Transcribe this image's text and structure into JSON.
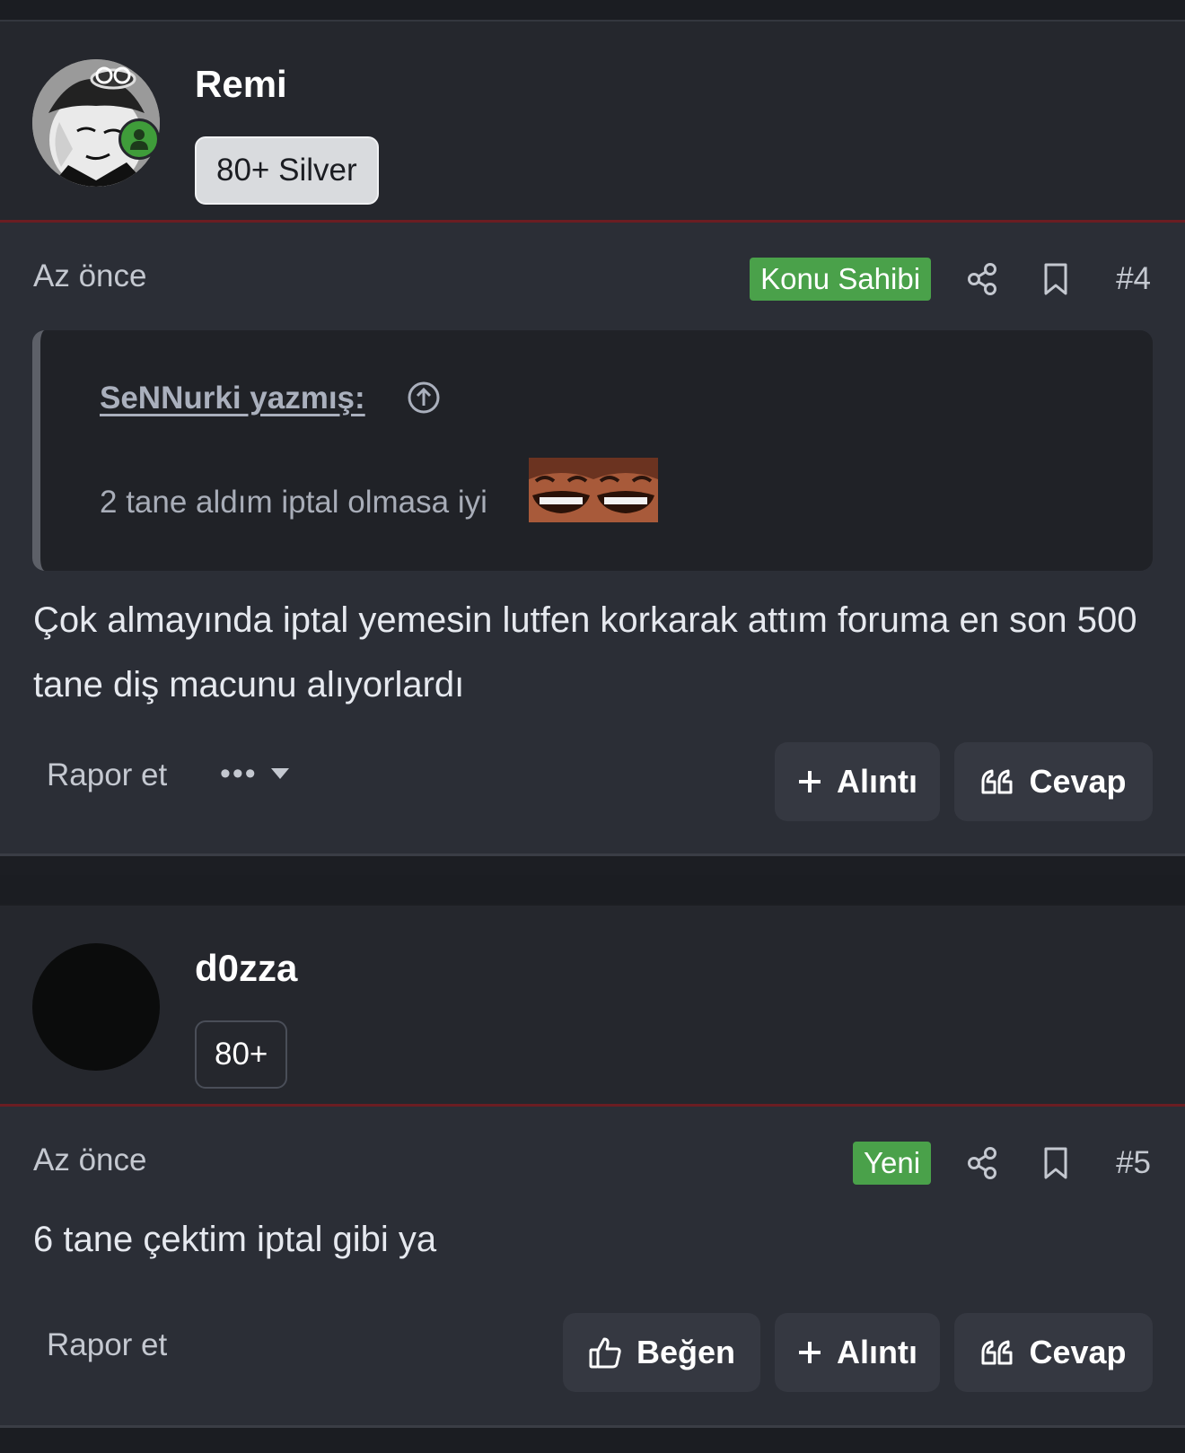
{
  "posts": [
    {
      "username": "Remi",
      "rank": "80+ Silver",
      "timestamp": "Az önce",
      "tag": "Konu Sahibi",
      "number": "#4",
      "quote": {
        "author": "SeNNurki yazmış:",
        "text": "2 tane aldım iptal olmasa iyi"
      },
      "message": "Çok almayında iptal yemesin lutfen korkarak attım foruma en son 500 tane diş macunu alıyorlardı",
      "actions": {
        "report": "Rapor et",
        "quote": "Alıntı",
        "reply": "Cevap"
      }
    },
    {
      "username": "d0zza",
      "rank": "80+",
      "timestamp": "Az önce",
      "tag": "Yeni",
      "number": "#5",
      "message": "6 tane çektim iptal gibi ya",
      "actions": {
        "report": "Rapor et",
        "like": "Beğen",
        "quote": "Alıntı",
        "reply": "Cevap"
      }
    }
  ],
  "colors": {
    "accent_green": "#4aa14a",
    "header_bg": "#25272d",
    "body_bg": "#2b2e36",
    "divider_red": "#6b1d22"
  },
  "icons": [
    "online-status-icon",
    "share-icon",
    "bookmark-icon",
    "arrow-up-circle-icon",
    "plus-icon",
    "quote-icon",
    "thumbs-up-icon",
    "chevron-down-icon"
  ]
}
